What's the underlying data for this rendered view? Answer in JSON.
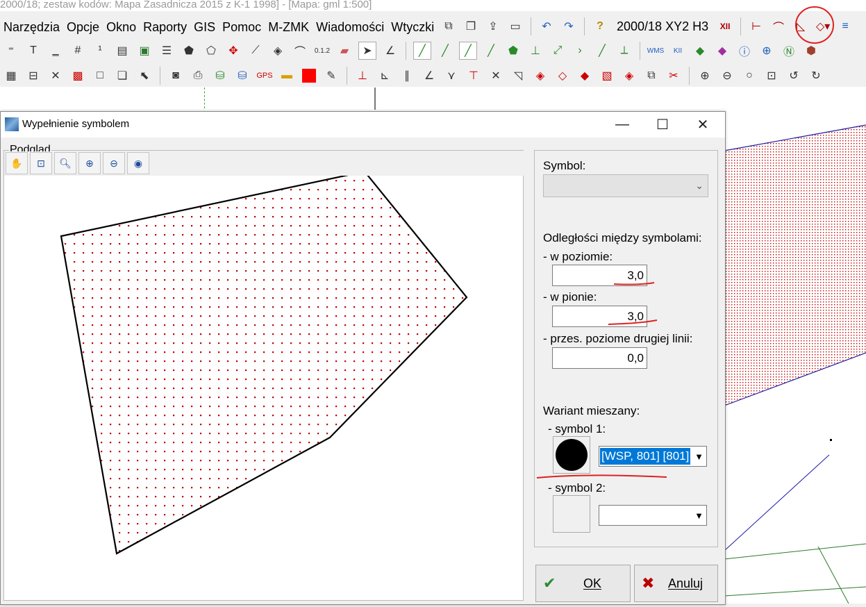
{
  "app": {
    "title_text": "2000/18; zestaw kodów: Mapa Zasadnicza 2015 z K-1 1998] - [Mapa: gml  1:500]"
  },
  "menu": {
    "items": [
      "Narzędzia",
      "Opcje",
      "Okno",
      "Raporty",
      "GIS",
      "Pomoc",
      "M-ZMK",
      "Wiadomości",
      "Wtyczki"
    ]
  },
  "toolbar": {
    "coord_system": "2000/18 XY2 H3",
    "layer_color": "#ff0000"
  },
  "dialog": {
    "title": "Wypełnienie symbolem",
    "preview_label": "Podgląd",
    "preview_tools": [
      "hand-icon",
      "zoom-region-icon",
      "zoom-icon",
      "zoom-in-icon",
      "zoom-out-icon",
      "globe-icon"
    ],
    "symbol_label": "Symbol:",
    "symbol_value": "",
    "spacing_label": "Odległości między symbolami:",
    "horizontal_label": "- w poziomie:",
    "horizontal_value": "3,0",
    "vertical_label": "- w pionie:",
    "vertical_value": "3,0",
    "offset_label": "- przes. poziome drugiej linii:",
    "offset_value": "0,0",
    "mixed_label": "Wariant mieszany:",
    "symbol1_label": "- symbol 1:",
    "symbol1_value": "[WSP, 801] [801]",
    "symbol2_label": "- symbol 2:",
    "symbol2_value": "",
    "ok_label": "OK",
    "cancel_label": "Anuluj",
    "fill_color": "#c00000",
    "accent": "#0078d7"
  }
}
